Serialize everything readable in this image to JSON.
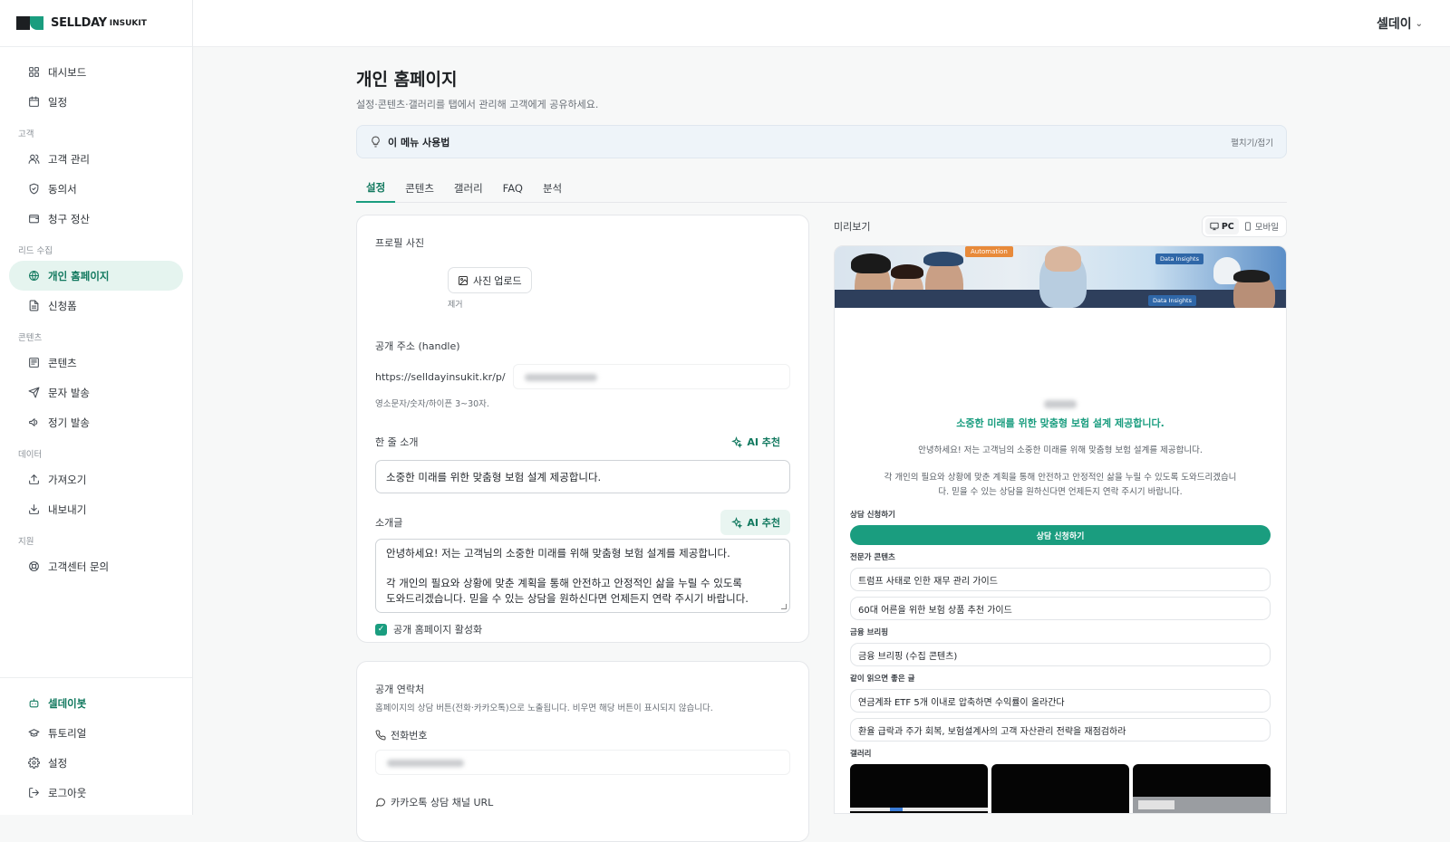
{
  "brand": {
    "name": "SELLDAY",
    "sub": "INSUKIT"
  },
  "user": {
    "name": "셀데이"
  },
  "sidebar": {
    "top_items": [
      {
        "label": "대시보드",
        "icon": "grid-icon"
      },
      {
        "label": "일정",
        "icon": "calendar-icon"
      }
    ],
    "sections": [
      {
        "title": "고객",
        "items": [
          {
            "label": "고객 관리",
            "icon": "users-icon"
          },
          {
            "label": "동의서",
            "icon": "shield-icon"
          },
          {
            "label": "청구 정산",
            "icon": "wallet-icon"
          }
        ]
      },
      {
        "title": "리드 수집",
        "items": [
          {
            "label": "개인 홈페이지",
            "icon": "globe-icon",
            "active": true
          },
          {
            "label": "신청폼",
            "icon": "form-icon"
          }
        ]
      },
      {
        "title": "콘텐츠",
        "items": [
          {
            "label": "콘텐츠",
            "icon": "newspaper-icon"
          },
          {
            "label": "문자 발송",
            "icon": "send-icon"
          },
          {
            "label": "정기 발송",
            "icon": "megaphone-icon"
          }
        ]
      },
      {
        "title": "데이터",
        "items": [
          {
            "label": "가져오기",
            "icon": "upload-icon"
          },
          {
            "label": "내보내기",
            "icon": "download-icon"
          }
        ]
      },
      {
        "title": "지원",
        "items": [
          {
            "label": "고객센터 문의",
            "icon": "lifebuoy-icon"
          }
        ]
      }
    ],
    "bottom_items": [
      {
        "label": "셀데이봇",
        "icon": "bot-icon",
        "accent": true
      },
      {
        "label": "튜토리얼",
        "icon": "graduation-cap-icon"
      },
      {
        "label": "설정",
        "icon": "gear-icon"
      },
      {
        "label": "로그아웃",
        "icon": "logout-icon"
      }
    ]
  },
  "page": {
    "title": "개인 홈페이지",
    "subtitle": "설정·콘텐츠·갤러리를 탭에서 관리해 고객에게 공유하세요.",
    "howto": {
      "label": "이 메뉴 사용법",
      "toggle": "펼치기/접기"
    },
    "tabs": [
      {
        "label": "설정",
        "active": true
      },
      {
        "label": "콘텐츠"
      },
      {
        "label": "갤러리"
      },
      {
        "label": "FAQ"
      },
      {
        "label": "분석"
      }
    ]
  },
  "settings": {
    "profile_photo_label": "프로필 사진",
    "upload_button": "사진 업로드",
    "remove_link": "제거",
    "handle_label": "공개 주소 (handle)",
    "handle_prefix": "https://selldayinsukit.kr/p/",
    "handle_hint": "영소문자/숫자/하이픈 3~30자.",
    "oneline_label": "한 줄 소개",
    "ai_button": "AI 추천",
    "oneline_value": "소중한 미래를 위한 맞춤형 보험 설계 제공합니다.",
    "intro_label": "소개글",
    "intro_value": "안녕하세요! 저는 고객님의 소중한 미래를 위해 맞춤형 보험 설계를 제공합니다.\n\n각 개인의 필요와 상황에 맞춘 계획을 통해 안전하고 안정적인 삶을 누릴 수 있도록\n도와드리겠습니다. 믿을 수 있는 상담을 원하신다면 언제든지 연락 주시기 바랍니다.",
    "public_toggle_label": "공개 홈페이지 활성화",
    "public_enabled": true
  },
  "contact": {
    "title": "공개 연락처",
    "desc": "홈페이지의 상담 버튼(전화·카카오톡)으로 노출됩니다. 비우면 해당 버튼이 표시되지 않습니다.",
    "phone_label": "전화번호",
    "kakao_label": "카카오톡 상담 채널 URL"
  },
  "preview": {
    "title": "미리보기",
    "device_pc": "PC",
    "device_mobile": "모바일",
    "banner_tag": "Automation",
    "banner_di1": "Data Insights",
    "banner_di2": "Data Insights",
    "headline": "소중한 미래를 위한 맞춤형 보험 설계 제공합니다.",
    "intro1": "안녕하세요! 저는 고객님의 소중한 미래를 위해 맞춤형 보험 설계를 제공합니다.",
    "intro2": "각 개인의 필요와 상황에 맞춘 계획을 통해 안전하고 안정적인 삶을 누릴 수 있도록 도와드리겠습니다. 믿을 수 있는 상담을 원하신다면 언제든지 연락 주시기 바랍니다.",
    "consult_label": "상담 신청하기",
    "consult_button": "상담 신청하기",
    "expert_label": "전문가 콘텐츠",
    "expert_items": [
      "트럼프 사태로 인한 재무 관리 가이드",
      "60대 어른을 위한 보험 상품 추천 가이드"
    ],
    "briefing_label": "금융 브리핑",
    "briefing_items": [
      "금융 브리핑 (수집 콘텐츠)"
    ],
    "reading_label": "같이 읽으면 좋은 글",
    "reading_items": [
      "연금계좌 ETF 5개 이내로 압축하면 수익률이 올라간다",
      "환율 급락과 주가 회복, 보험설계사의 고객 자산관리 전략을 재점검하라"
    ],
    "gallery_label": "갤러리"
  },
  "colors": {
    "accent": "#1a9d7f",
    "accent_light": "#e5f4ef"
  }
}
